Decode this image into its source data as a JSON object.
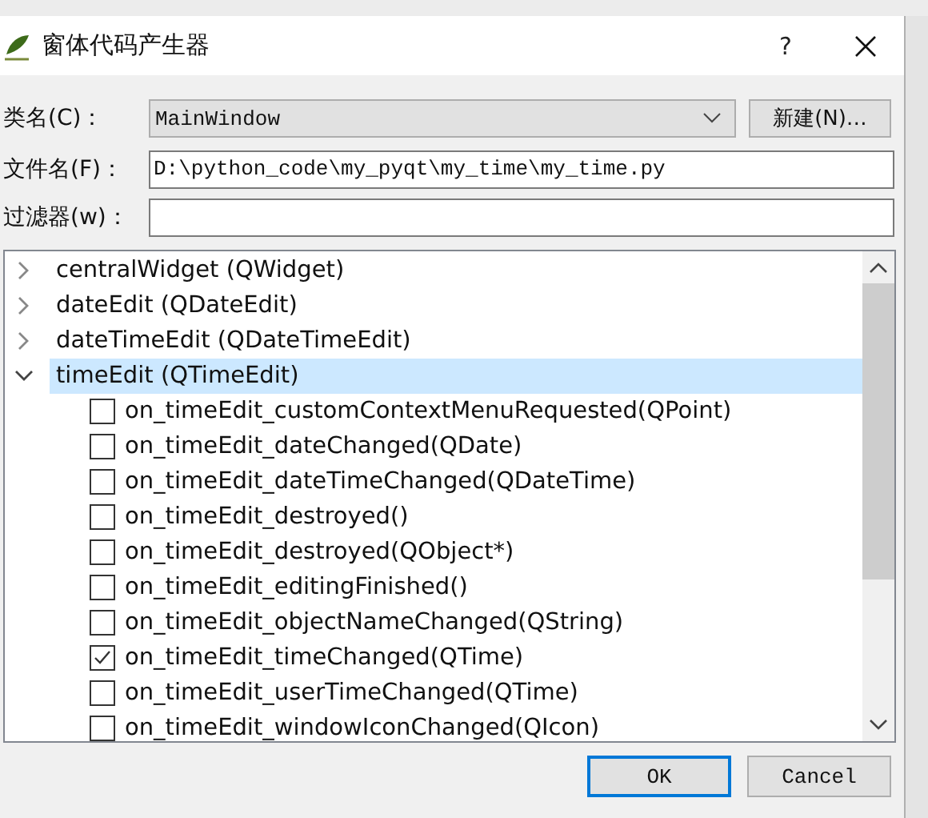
{
  "window": {
    "title": "窗体代码产生器",
    "help": "?"
  },
  "form": [
    {
      "kind": "combo",
      "label": "类名(C)：",
      "value": "MainWindow",
      "button": "新建(N)…"
    },
    {
      "kind": "field",
      "label": "文件名(F)：",
      "value": "D:\\python_code\\my_pyqt\\my_time\\my_time.py"
    },
    {
      "kind": "field",
      "label": "过滤器(w)："
    }
  ],
  "tree": [
    {
      "label": "centralWidget (QWidget)",
      "expanded": false,
      "selected": false
    },
    {
      "label": "dateEdit (QDateEdit)",
      "expanded": false,
      "selected": false
    },
    {
      "label": "dateTimeEdit (QDateTimeEdit)",
      "expanded": false,
      "selected": false
    },
    {
      "label": "timeEdit (QTimeEdit)",
      "expanded": true,
      "selected": true,
      "children": [
        {
          "label": "on_timeEdit_customContextMenuRequested(QPoint)",
          "checked": false
        },
        {
          "label": "on_timeEdit_dateChanged(QDate)",
          "checked": false
        },
        {
          "label": "on_timeEdit_dateTimeChanged(QDateTime)",
          "checked": false
        },
        {
          "label": "on_timeEdit_destroyed()",
          "checked": false
        },
        {
          "label": "on_timeEdit_destroyed(QObject*)",
          "checked": false
        },
        {
          "label": "on_timeEdit_editingFinished()",
          "checked": false
        },
        {
          "label": "on_timeEdit_objectNameChanged(QString)",
          "checked": false
        },
        {
          "label": "on_timeEdit_timeChanged(QTime)",
          "checked": true
        },
        {
          "label": "on_timeEdit_userTimeChanged(QTime)",
          "checked": false
        },
        {
          "label": "on_timeEdit_windowIconChanged(QIcon)",
          "checked": false
        }
      ]
    }
  ],
  "buttons": [
    {
      "label": "OK",
      "default": true
    },
    {
      "label": "Cancel",
      "default": false
    }
  ]
}
